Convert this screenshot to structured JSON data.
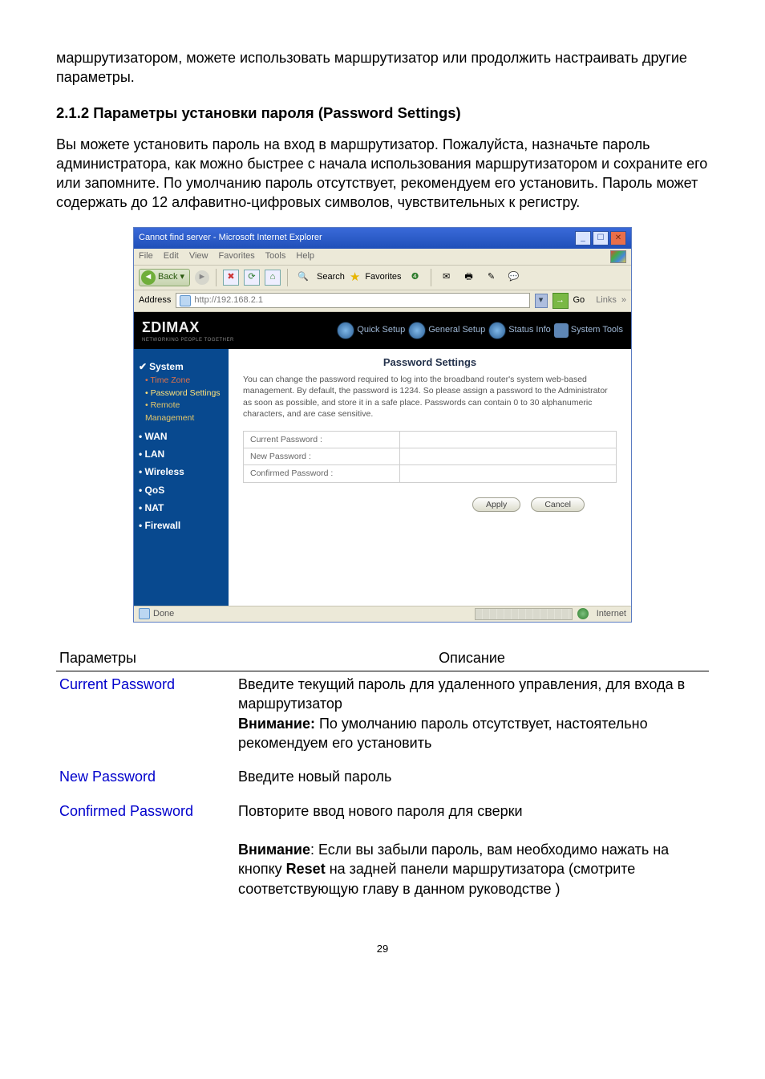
{
  "intro_paragraph": "маршрутизатором, можете использовать маршрутизатор или продолжить настраивать другие параметры.",
  "heading": "2.1.2 Параметры установки пароля (Password Settings)",
  "desc_paragraph": "Вы можете установить пароль на вход в маршрутизатор. Пожалуйста, назначьте пароль администратора, как можно быстрее с начала использования маршрутизатором и сохраните его или запомните. По умолчанию пароль отсутствует, рекомендуем его установить. Пароль может содержать до 12 алфавитно-цифровых символов, чувствительных к регистру.",
  "browser": {
    "title": "Cannot find server - Microsoft Internet Explorer",
    "menus": [
      "File",
      "Edit",
      "View",
      "Favorites",
      "Tools",
      "Help"
    ],
    "back_label": "Back",
    "search_label": "Search",
    "fav_label": "Favorites",
    "address_label": "Address",
    "address_value": "http://192.168.2.1",
    "go_label": "Go",
    "links_label": "Links",
    "status_left": "Done",
    "status_right": "Internet"
  },
  "router": {
    "logo": "ΣDIMAX",
    "logo_sub": "NETWORKING PEOPLE TOGETHER",
    "nav": [
      "Quick Setup",
      "General Setup",
      "Status Info",
      "System Tools"
    ],
    "side": {
      "system": "System",
      "subs": [
        "Time Zone",
        "Password Settings",
        "Remote Management"
      ],
      "cats": [
        "WAN",
        "LAN",
        "Wireless",
        "QoS",
        "NAT",
        "Firewall"
      ]
    },
    "content": {
      "title": "Password Settings",
      "desc": "You can change the password required to log into the broadband router's system web-based management. By default, the password is 1234. So please assign a password to the Administrator as soon as possible, and store it in a safe place. Passwords can contain 0 to 30 alphanumeric characters, and are case sensitive.",
      "fields": {
        "current": "Current Password :",
        "new": "New Password :",
        "confirm": "Confirmed Password :"
      },
      "apply": "Apply",
      "cancel": "Cancel"
    }
  },
  "params_table": {
    "head_param": "Параметры",
    "head_desc": "Описание",
    "rows": [
      {
        "key": "Current Password",
        "val_pre": "Введите текущий пароль для удаленного управления, для входа в маршрутизатор",
        "note_label": "Внимание:",
        "note_rest": " По умолчанию пароль отсутствует, настоятельно рекомендуем его установить"
      },
      {
        "key": "New Password",
        "val_pre": "Введите новый пароль"
      },
      {
        "key": "Confirmed Password",
        "val_pre": "Повторите ввод нового пароля для сверки"
      }
    ],
    "footer_note_label": "Внимание",
    "footer_note_sep": ": ",
    "footer_note_pre": "Если вы забыли пароль, вам необходимо нажать на кнопку ",
    "footer_note_bold": "Reset",
    "footer_note_post": " на задней панели маршрутизатора (смотрите соответствующую главу в данном руководстве )"
  },
  "page_number": "29"
}
